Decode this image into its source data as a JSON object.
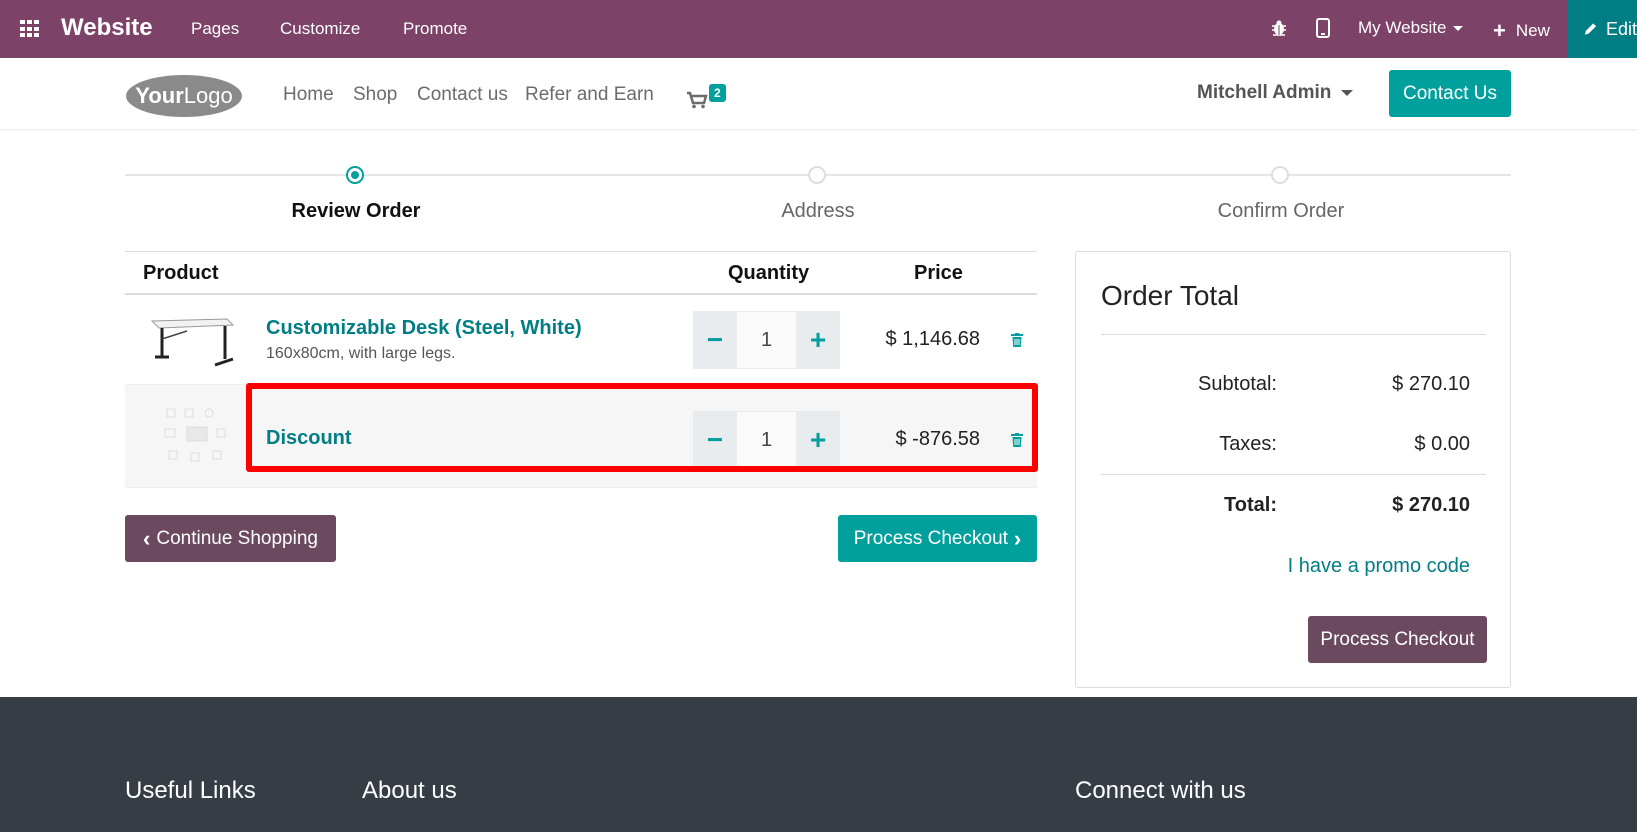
{
  "topbar": {
    "brand": "Website",
    "menu": [
      "Pages",
      "Customize",
      "Promote"
    ],
    "my_website": "My Website",
    "new_label": "New",
    "edit_label": "Edit"
  },
  "header": {
    "logo_alt": "Your Logo",
    "nav": [
      "Home",
      "Shop",
      "Contact us",
      "Refer and Earn"
    ],
    "cart_count": "2",
    "user": "Mitchell Admin",
    "contact_button": "Contact Us"
  },
  "steps": [
    {
      "label": "Review Order",
      "active": true
    },
    {
      "label": "Address",
      "active": false
    },
    {
      "label": "Confirm Order",
      "active": false
    }
  ],
  "table": {
    "headers": {
      "product": "Product",
      "quantity": "Quantity",
      "price": "Price"
    },
    "rows": [
      {
        "name": "Customizable Desk (Steel, White)",
        "description": "160x80cm, with large legs.",
        "quantity": "1",
        "price": "$ 1,146.68"
      },
      {
        "name": "Discount",
        "description": "",
        "quantity": "1",
        "price": "$ -876.58"
      }
    ]
  },
  "actions": {
    "continue": "Continue Shopping",
    "process": "Process Checkout"
  },
  "summary": {
    "title": "Order Total",
    "subtotal_label": "Subtotal:",
    "subtotal": "$ 270.10",
    "taxes_label": "Taxes:",
    "taxes": "$ 0.00",
    "total_label": "Total:",
    "total": "$ 270.10",
    "promo": "I have a promo code",
    "process": "Process Checkout"
  },
  "footer": {
    "col1": "Useful Links",
    "col2": "About us",
    "col3": "Connect with us"
  },
  "colors": {
    "topbar": "#7c4267",
    "accent": "#01a09d",
    "secondary": "#6b4a5f",
    "highlight": "#ff0000",
    "footer": "#363d45"
  }
}
